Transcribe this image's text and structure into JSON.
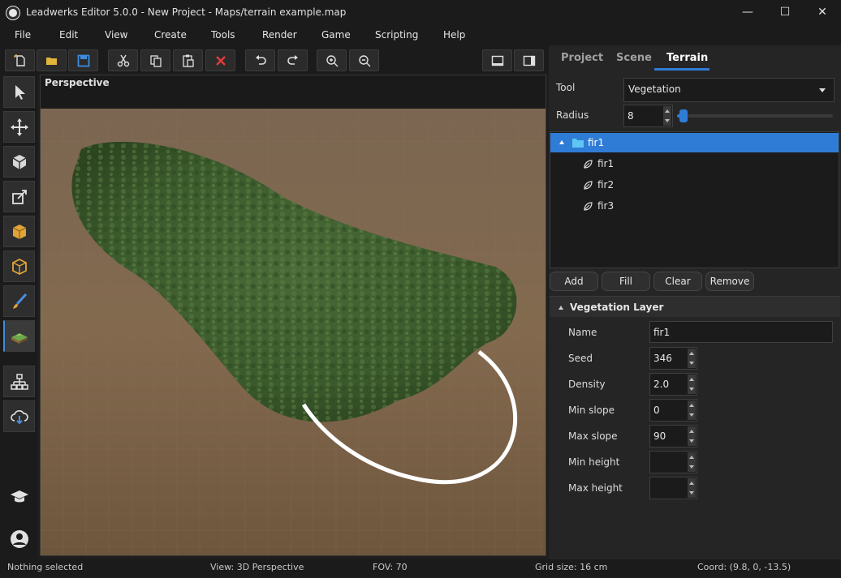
{
  "window": {
    "title": "Leadwerks Editor 5.0.0 - New Project - Maps/terrain example.map",
    "minimize_glyph": "—",
    "maximize_glyph": "☐",
    "close_glyph": "✕"
  },
  "menu": [
    "File",
    "Edit",
    "View",
    "Create",
    "Tools",
    "Render",
    "Game",
    "Scripting",
    "Help"
  ],
  "toolbar_icons": [
    "new-file-icon",
    "open-folder-icon",
    "save-icon",
    "cut-icon",
    "copy-icon",
    "paste-icon",
    "delete-icon",
    "undo-icon",
    "redo-icon",
    "zoom-in-icon",
    "zoom-out-icon",
    "single-view-icon",
    "sidebar-view-icon"
  ],
  "toolbox_icons": [
    "select-icon",
    "move-icon",
    "create-object-icon",
    "edit-face-icon",
    "box-icon",
    "brush-vertex-icon",
    "paint-icon",
    "terrain-icon",
    "hierarchy-icon",
    "cloud-download-icon",
    "tutorial-icon",
    "user-icon"
  ],
  "viewport": {
    "label": "Perspective"
  },
  "right_panel": {
    "tabs": [
      "Project",
      "Scene",
      "Terrain"
    ],
    "active_tab": "Terrain",
    "tool_label": "Tool",
    "tool_value": "Vegetation",
    "radius_label": "Radius",
    "radius_value": "8",
    "radius_fraction": 0.04,
    "tree": {
      "root": "fir1",
      "children": [
        "fir1",
        "fir2",
        "fir3"
      ]
    },
    "buttons": {
      "add": "Add",
      "fill": "Fill",
      "clear": "Clear",
      "remove": "Remove"
    },
    "section_title": "Vegetation Layer",
    "properties": {
      "name_label": "Name",
      "name_value": "fir1",
      "seed_label": "Seed",
      "seed_value": "346",
      "density_label": "Density",
      "density_value": "2.0",
      "min_slope_label": "Min slope",
      "min_slope_value": "0",
      "max_slope_label": "Max slope",
      "max_slope_value": "90",
      "min_height_label": "Min height",
      "min_height_value": "",
      "max_height_label": "Max height",
      "max_height_value": ""
    }
  },
  "status": {
    "selection": "Nothing selected",
    "view": "View: 3D Perspective",
    "fov": "FOV: 70",
    "grid": "Grid size: 16 cm",
    "coord": "Coord: (9.8, 0, -13.5)"
  },
  "colors": {
    "accent": "#2f7cd6",
    "terrain": "#7e6448",
    "foliage": "#3e5a2e"
  }
}
